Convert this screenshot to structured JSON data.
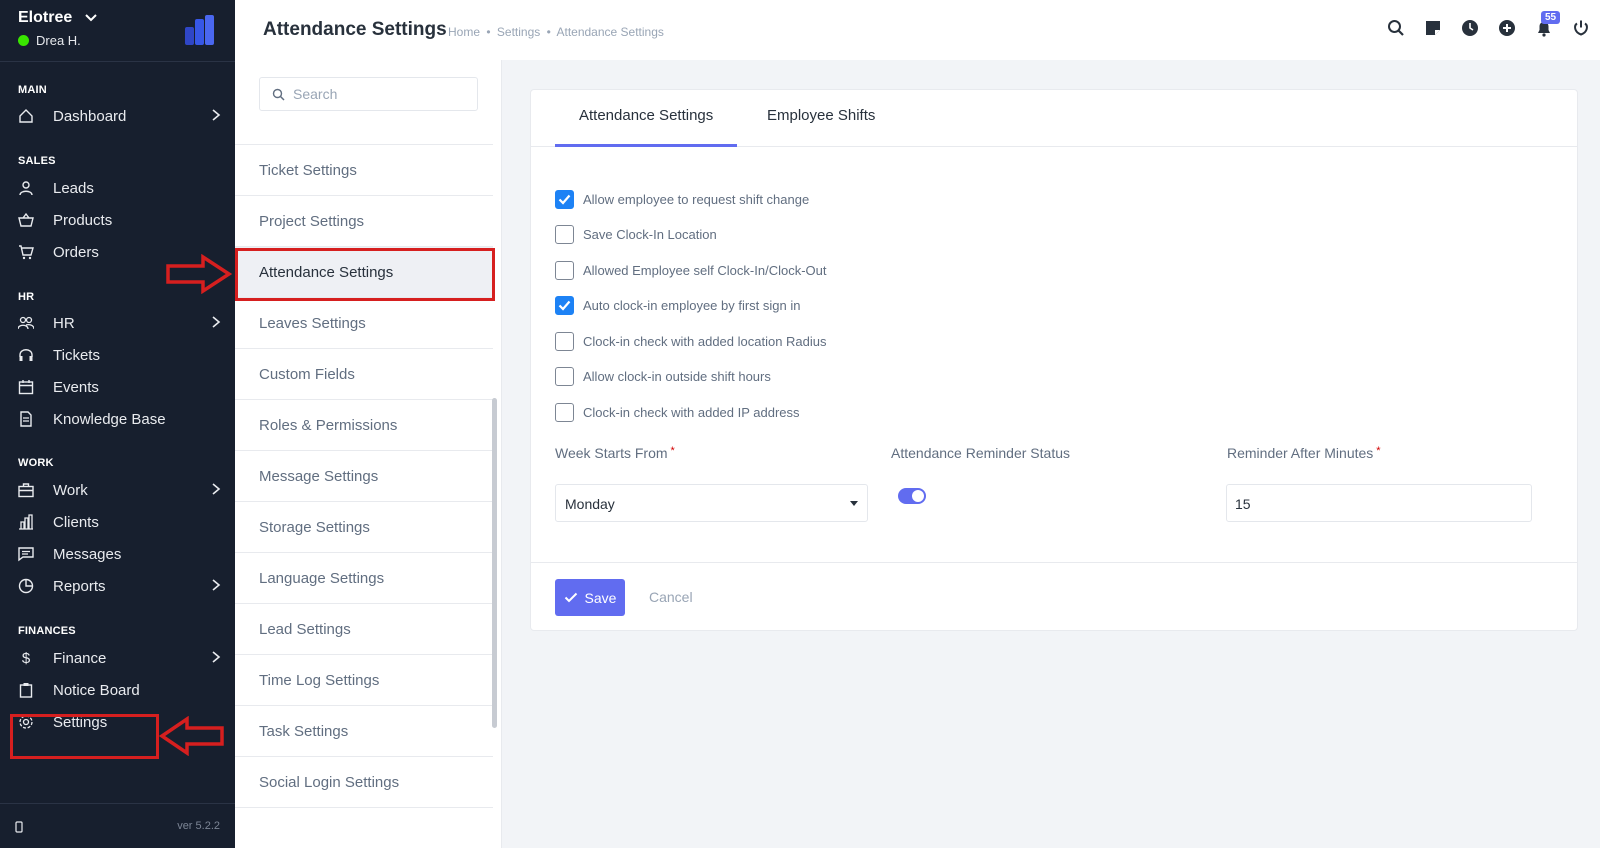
{
  "sidebar": {
    "company": "Elotree",
    "user": "Drea H.",
    "sections": {
      "main": "MAIN",
      "sales": "SALES",
      "hr": "HR",
      "work": "WORK",
      "finances": "FINANCES"
    },
    "items": [
      {
        "label": "Dashboard",
        "icon": "house-icon"
      },
      {
        "label": "Leads",
        "icon": "person-icon"
      },
      {
        "label": "Products",
        "icon": "basket-icon"
      },
      {
        "label": "Orders",
        "icon": "cart-icon"
      },
      {
        "label": "HR",
        "icon": "people-icon"
      },
      {
        "label": "Tickets",
        "icon": "headset-icon"
      },
      {
        "label": "Events",
        "icon": "calendar-icon"
      },
      {
        "label": "Knowledge Base",
        "icon": "document-icon"
      },
      {
        "label": "Work",
        "icon": "briefcase-icon"
      },
      {
        "label": "Clients",
        "icon": "building-icon"
      },
      {
        "label": "Messages",
        "icon": "chat-icon"
      },
      {
        "label": "Reports",
        "icon": "pie-chart-icon"
      },
      {
        "label": "Finance",
        "icon": "dollar-icon"
      },
      {
        "label": "Notice Board",
        "icon": "clipboard-icon"
      },
      {
        "label": "Settings",
        "icon": "gear-icon"
      }
    ],
    "version": "ver 5.2.2"
  },
  "topbar": {
    "title": "Attendance Settings",
    "breadcrumbs": [
      "Home",
      "•",
      "Settings",
      "•",
      "Attendance Settings"
    ],
    "notification_count": "55"
  },
  "settings_menu": {
    "search_placeholder": "Search",
    "items": [
      "Ticket Settings",
      "Project Settings",
      "Attendance Settings",
      "Leaves Settings",
      "Custom Fields",
      "Roles & Permissions",
      "Message Settings",
      "Storage Settings",
      "Language Settings",
      "Lead Settings",
      "Time Log Settings",
      "Task Settings",
      "Social Login Settings"
    ],
    "active": "Attendance Settings"
  },
  "card": {
    "tabs": [
      "Attendance Settings",
      "Employee Shifts"
    ],
    "active_tab": "Attendance Settings",
    "checkboxes": [
      {
        "label": "Allow employee to request shift change",
        "checked": true
      },
      {
        "label": "Save Clock-In Location",
        "checked": false
      },
      {
        "label": "Allowed Employee self Clock-In/Clock-Out",
        "checked": false
      },
      {
        "label": "Auto clock-in employee by first sign in",
        "checked": true
      },
      {
        "label": "Clock-in check with added location Radius",
        "checked": false
      },
      {
        "label": "Allow clock-in outside shift hours",
        "checked": false
      },
      {
        "label": "Clock-in check with added IP address",
        "checked": false
      }
    ],
    "week_starts_label": "Week Starts From",
    "week_starts_value": "Monday",
    "reminder_status_label": "Attendance Reminder Status",
    "reminder_status_on": true,
    "reminder_minutes_label": "Reminder After Minutes",
    "reminder_minutes_value": "15",
    "required_mark": "*",
    "save_label": "Save",
    "cancel_label": "Cancel"
  },
  "colors": {
    "sidebar_bg": "#171f2e",
    "accent": "#616cf0",
    "checkbox_blue": "#1d82f5",
    "annotation_red": "#d61f1f"
  }
}
